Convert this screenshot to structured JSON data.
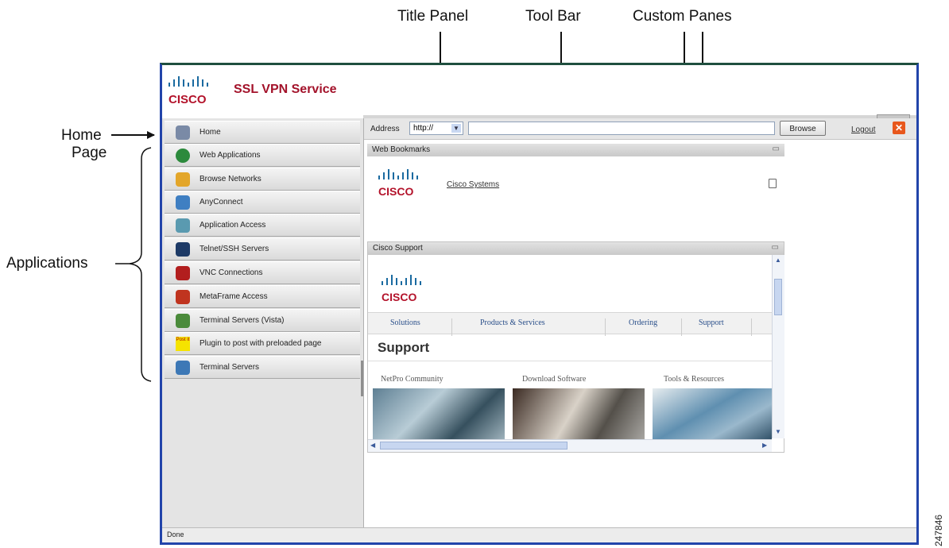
{
  "callouts": {
    "title_panel": "Title Panel",
    "tool_bar": "Tool Bar",
    "custom_panes": "Custom Panes",
    "home_page_line1": "Home",
    "home_page_line2": "Page",
    "applications": "Applications"
  },
  "header": {
    "app_title": "SSL VPN Service",
    "logo_text": "CISCO"
  },
  "nav": {
    "items": [
      {
        "label": "Home",
        "icon": "home-icon",
        "color": "#7a8aa6"
      },
      {
        "label": "Web Applications",
        "icon": "globe-icon",
        "color": "#2c8a3c"
      },
      {
        "label": "Browse Networks",
        "icon": "network-folder-icon",
        "color": "#e3a62a"
      },
      {
        "label": "AnyConnect",
        "icon": "anyconnect-icon",
        "color": "#3f7fc2"
      },
      {
        "label": "Application Access",
        "icon": "app-access-icon",
        "color": "#5a9ab0"
      },
      {
        "label": "Telnet/SSH Servers",
        "icon": "terminal-icon",
        "color": "#1d3a66"
      },
      {
        "label": "VNC Connections",
        "icon": "vnc-icon",
        "color": "#b21e1e"
      },
      {
        "label": "MetaFrame Access",
        "icon": "metaframe-icon",
        "color": "#c0341f"
      },
      {
        "label": "Terminal Servers (Vista)",
        "icon": "vista-terminal-icon",
        "color": "#4b8b3b"
      },
      {
        "label": "Plugin to post with preloaded page",
        "icon": "post-it-icon",
        "color": "#f5e300"
      },
      {
        "label": "Terminal Servers",
        "icon": "terminal-servers-icon",
        "color": "#3d78b6"
      }
    ],
    "post_it_text": "Post it"
  },
  "toolbar": {
    "address_label": "Address",
    "protocol_value": "http://",
    "url_value": "",
    "browse_label": "Browse",
    "logout_label": "Logout"
  },
  "panes": {
    "bookmarks": {
      "title": "Web Bookmarks",
      "link": "Cisco Systems"
    },
    "support": {
      "title": "Cisco Support",
      "nav": [
        "Solutions",
        "Products & Services",
        "Ordering",
        "Support"
      ],
      "heading": "Support",
      "columns": [
        "NetPro Community",
        "Download Software",
        "Tools & Resources"
      ]
    }
  },
  "status": {
    "text": "Done"
  },
  "figure_id": "247846",
  "colors": {
    "brand_red": "#a3122a",
    "window_border": "#2244aa",
    "logout_x": "#e8571c"
  }
}
